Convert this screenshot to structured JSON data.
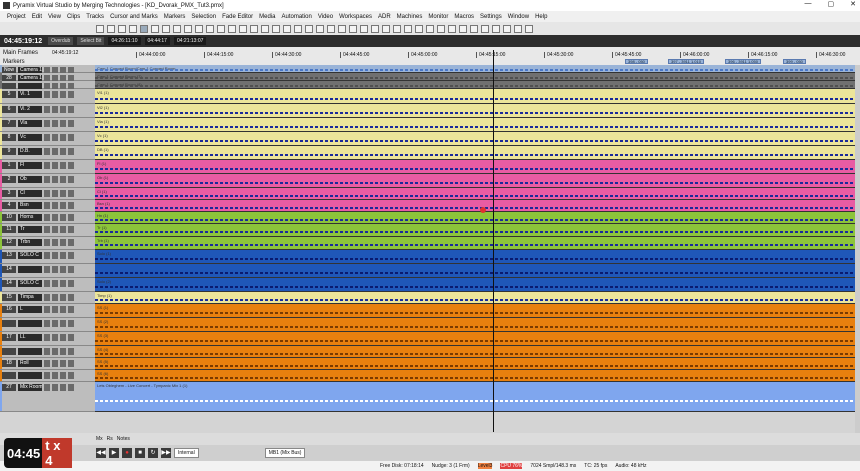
{
  "window": {
    "title": "Pyramix Virtual Studio by Merging Technologies - [KD_Dvorak_PMX_Tut3.pmx]",
    "minimize": "—",
    "maximize": "▢",
    "close": "✕"
  },
  "menu": [
    "Project",
    "Edit",
    "View",
    "Clips",
    "Tracks",
    "Cursor and Marks",
    "Markers",
    "Selection",
    "Fade Editor",
    "Media",
    "Automation",
    "Video",
    "Workspaces",
    "ADR",
    "Machines",
    "Monitor",
    "Macros",
    "Settings",
    "Window",
    "Help"
  ],
  "transport": {
    "timecode": "04:45:19:12",
    "mode": "Overdub",
    "segment": "Select Bit",
    "in": "04:26:11:10",
    "out": "04:44:17",
    "len": "04:21:13:07"
  },
  "ruler": {
    "main_frames_label": "Main Frames",
    "main_frames_value": "04:45:19:12",
    "markers_label": "Markers",
    "ticks": [
      "04:44:00:00",
      "04:44:15:00",
      "04:44:30:00",
      "04:44:45:00",
      "04:45:00:00",
      "04:45:15:00",
      "04:45:30:00",
      "04:45:45:00",
      "04:46:00:00",
      "04:46:15:00",
      "04:46:30:00"
    ],
    "markers": [
      "398 - 050",
      "397 - 3911 1.010",
      "396 - 3911 1.050",
      "399 - 050"
    ]
  },
  "tracks": [
    {
      "num": "Now",
      "name": "Camera 1",
      "color": "#9ab4d8",
      "clip": "Cam 1 Concert Room/Cam 1 Concert Room",
      "wave": "#4a78c8",
      "h": 8
    },
    {
      "num": "28",
      "name": "Camera 1b",
      "color": "#707070",
      "clip": "Cam 1 Concert Room (7)",
      "wave": "#505050",
      "h": 8
    },
    {
      "num": "",
      "name": "",
      "color": "#707070",
      "clip": "Cam 1 Concert Room (8)",
      "wave": "#505050",
      "h": 8
    },
    {
      "num": "5",
      "name": "Vi. 1",
      "color": "#ece59a",
      "clip": "Vl1 (1)",
      "wave": "#1a2a9a",
      "h": 15
    },
    {
      "num": "6",
      "name": "Vi. 2",
      "color": "#ece59a",
      "clip": "Vl2 (1)",
      "wave": "#1a2a9a",
      "h": 14
    },
    {
      "num": "7",
      "name": "Vla",
      "color": "#ece59a",
      "clip": "Vla (1)",
      "wave": "#1a2a9a",
      "h": 14
    },
    {
      "num": "8",
      "name": "Vc",
      "color": "#ece59a",
      "clip": "Vc (1)",
      "wave": "#1a2a9a",
      "h": 14
    },
    {
      "num": "9",
      "name": "D.B.",
      "color": "#ece59a",
      "clip": "DB (1)",
      "wave": "#1a2a9a",
      "h": 14
    },
    {
      "num": "1",
      "name": "Fl",
      "color": "#e85ca3",
      "clip": "Fl (1)",
      "wave": "#1a2a9a",
      "h": 14
    },
    {
      "num": "2",
      "name": "Ob",
      "color": "#e85ca3",
      "clip": "Ob (1)",
      "wave": "#1a2a9a",
      "h": 14
    },
    {
      "num": "3",
      "name": "Cl",
      "color": "#e85ca3",
      "clip": "Cl (1)",
      "wave": "#1a2a9a",
      "h": 12
    },
    {
      "num": "4",
      "name": "Bsn",
      "color": "#e85ca3",
      "clip": "Bsn (1)",
      "wave": "#1a2a9a",
      "h": 12
    },
    {
      "num": "10",
      "name": "Horns",
      "color": "#8cc43a",
      "clip": "Hn (1)",
      "wave": "#1a2a9a",
      "h": 12
    },
    {
      "num": "11",
      "name": "Tr",
      "color": "#8cc43a",
      "clip": "Tr (1)",
      "wave": "#1a2a9a",
      "h": 13
    },
    {
      "num": "12",
      "name": "Trbn",
      "color": "#8cc43a",
      "clip": "Trb (1)",
      "wave": "#1a2a9a",
      "h": 13
    },
    {
      "num": "13",
      "name": "SOLO C",
      "color": "#1f57b8",
      "clip": "Solo (1)",
      "wave": "#0a1a70",
      "h": 14
    },
    {
      "num": "14",
      "name": "",
      "color": "#1f57b8",
      "clip": "",
      "wave": "#0a1a70",
      "h": 14
    },
    {
      "num": "14",
      "name": "SOLO C",
      "color": "#1f57b8",
      "clip": "Solo (2)",
      "wave": "#0a1a70",
      "h": 14
    },
    {
      "num": "15",
      "name": "Timpa",
      "color": "#ece59a",
      "clip": "Timp (1)",
      "wave": "#1a2a9a",
      "h": 12
    },
    {
      "num": "16",
      "name": "L",
      "color": "#e8800e",
      "clip": "SS (1)",
      "wave": "#7a3a00",
      "h": 14
    },
    {
      "num": "",
      "name": "",
      "color": "#e8800e",
      "clip": "SS (2)",
      "wave": "#7a3a00",
      "h": 14
    },
    {
      "num": "17",
      "name": "LL",
      "color": "#e8800e",
      "clip": "SS (3)",
      "wave": "#7a3a00",
      "h": 14
    },
    {
      "num": "",
      "name": "",
      "color": "#e8800e",
      "clip": "SS (4)",
      "wave": "#7a3a00",
      "h": 12
    },
    {
      "num": "18",
      "name": "Roll",
      "color": "#e8800e",
      "clip": "SS (5)",
      "wave": "#7a3a00",
      "h": 12
    },
    {
      "num": "",
      "name": "",
      "color": "#e8800e",
      "clip": "SS (6)",
      "wave": "#7a3a00",
      "h": 12
    },
    {
      "num": "27",
      "name": "Mix Room",
      "color": "#7fa6ee",
      "clip": "Lets Obleghem - Live Concert - Tympanic Mix 1 (1)",
      "wave": "#ffffff",
      "h": 30
    }
  ],
  "tabs": [
    "Mx",
    "Rs",
    "Notes"
  ],
  "bottom": {
    "play": "PLAY",
    "sync": "Internal",
    "bus": "MB1 (Mix Bus)"
  },
  "status": {
    "free_disk": "Free Disk: 07:18:14",
    "nudge": "Nudge: 3 (1 Frm)",
    "level": "Level3",
    "cpu": "CPU 76%",
    "smpl": "7024 Smpl/148.3 ms",
    "tc": "TC: 25 fps",
    "audio": "Audio: 48 kHz"
  },
  "overlay": {
    "time": "04:45",
    "speed": "t x 4"
  }
}
